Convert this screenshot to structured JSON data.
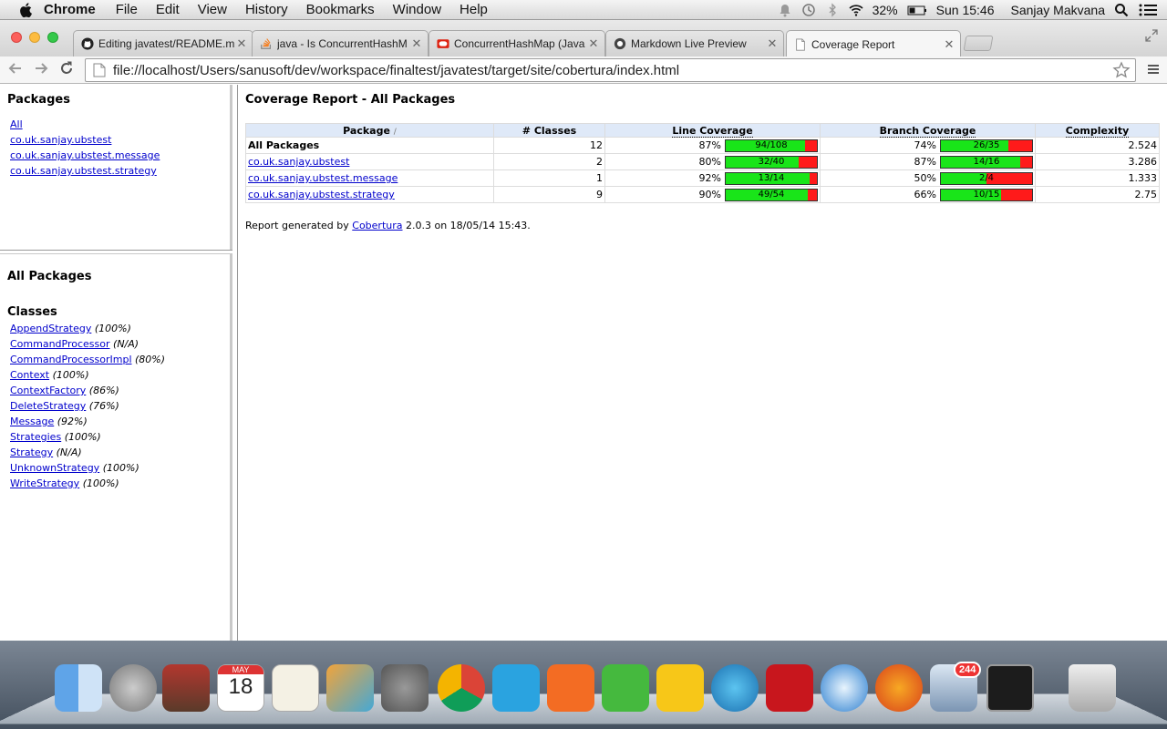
{
  "menubar": {
    "app_name": "Chrome",
    "items": [
      "File",
      "Edit",
      "View",
      "History",
      "Bookmarks",
      "Window",
      "Help"
    ],
    "battery": "32%",
    "clock": "Sun 15:46",
    "user": "Sanjay Makvana"
  },
  "browser": {
    "tabs": [
      {
        "title": "Editing javatest/README.m",
        "icon": "github-icon"
      },
      {
        "title": "java - Is ConcurrentHashM",
        "icon": "stackoverflow-icon"
      },
      {
        "title": "ConcurrentHashMap (Java",
        "icon": "oracle-icon"
      },
      {
        "title": "Markdown Live Preview",
        "icon": "markdown-icon"
      },
      {
        "title": "Coverage Report",
        "icon": "page-icon"
      }
    ],
    "active_tab": 4,
    "url": "file://localhost/Users/sanusoft/dev/workspace/finaltest/javatest/target/site/cobertura/index.html"
  },
  "packages_frame": {
    "heading": "Packages",
    "items": [
      "All",
      "co.uk.sanjay.ubstest",
      "co.uk.sanjay.ubstest.message",
      "co.uk.sanjay.ubstest.strategy"
    ]
  },
  "classes_frame": {
    "heading": "All Packages",
    "subheading": "Classes",
    "items": [
      {
        "name": "AppendStrategy",
        "pct": "(100%)"
      },
      {
        "name": "CommandProcessor",
        "pct": "(N/A)"
      },
      {
        "name": "CommandProcessorImpl",
        "pct": "(80%)"
      },
      {
        "name": "Context",
        "pct": "(100%)"
      },
      {
        "name": "ContextFactory",
        "pct": "(86%)"
      },
      {
        "name": "DeleteStrategy",
        "pct": "(76%)"
      },
      {
        "name": "Message",
        "pct": "(92%)"
      },
      {
        "name": "Strategies",
        "pct": "(100%)"
      },
      {
        "name": "Strategy",
        "pct": "(N/A)"
      },
      {
        "name": "UnknownStrategy",
        "pct": "(100%)"
      },
      {
        "name": "WriteStrategy",
        "pct": "(100%)"
      }
    ]
  },
  "summary": {
    "title": "Coverage Report - All Packages",
    "columns": [
      "Package",
      "# Classes",
      "Line Coverage",
      "Branch Coverage",
      "Complexity"
    ],
    "sort_marker": "/",
    "rows": [
      {
        "package": "All Packages",
        "is_link": false,
        "classes": "12",
        "line_pct": "87%",
        "line_frac": "94/108",
        "line_value": 0.87,
        "branch_pct": "74%",
        "branch_frac": "26/35",
        "branch_value": 0.74,
        "complexity": "2.524"
      },
      {
        "package": "co.uk.sanjay.ubstest",
        "is_link": true,
        "classes": "2",
        "line_pct": "80%",
        "line_frac": "32/40",
        "line_value": 0.8,
        "branch_pct": "87%",
        "branch_frac": "14/16",
        "branch_value": 0.87,
        "complexity": "3.286"
      },
      {
        "package": "co.uk.sanjay.ubstest.message",
        "is_link": true,
        "classes": "1",
        "line_pct": "92%",
        "line_frac": "13/14",
        "line_value": 0.92,
        "branch_pct": "50%",
        "branch_frac": "2/4",
        "branch_value": 0.5,
        "complexity": "1.333"
      },
      {
        "package": "co.uk.sanjay.ubstest.strategy",
        "is_link": true,
        "classes": "9",
        "line_pct": "90%",
        "line_frac": "49/54",
        "line_value": 0.9,
        "branch_pct": "66%",
        "branch_frac": "10/15",
        "branch_value": 0.66,
        "complexity": "2.75"
      }
    ],
    "footer_prefix": "Report generated by",
    "footer_link": "Cobertura",
    "footer_suffix": "2.0.3 on 18/05/14 15:43."
  },
  "dock": {
    "icons": [
      "finder-icon",
      "launchpad-icon",
      "photo-booth-icon",
      "calendar-icon",
      "reminders-icon",
      "intellij-icon",
      "system-preferences-icon",
      "chrome-icon",
      "word-icon",
      "powerpoint-icon",
      "excel-icon",
      "outlook-icon",
      "download-icon",
      "acrobat-icon",
      "safari-icon",
      "firefox-icon",
      "mail-icon",
      "terminal-icon",
      "trash-icon"
    ],
    "calendar_month": "MAY",
    "calendar_day": "18",
    "mail_badge": "244"
  },
  "colors": {
    "covered": "#19e519",
    "uncovered": "#ff1a1a",
    "header_bg": "#dfe9f8",
    "link": "#0000cc"
  }
}
